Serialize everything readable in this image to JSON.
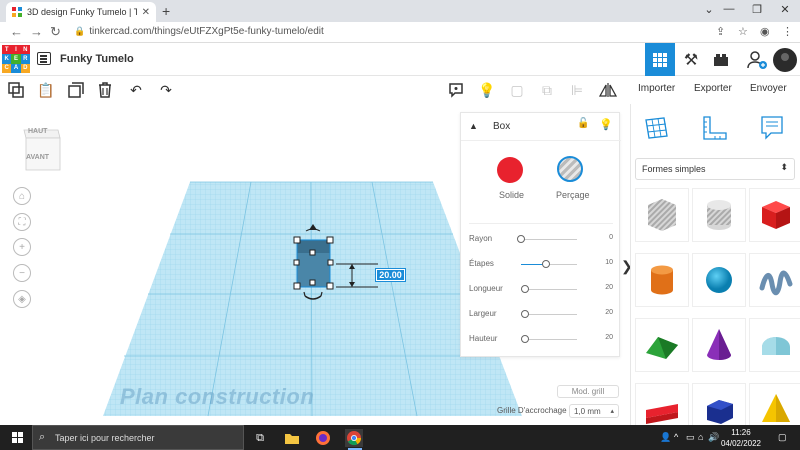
{
  "browser": {
    "tab_title": "3D design Funky Tumelo | Tinker",
    "tab_close": "✕",
    "new_tab": "+",
    "url": "tinkercad.com/things/eUtFZXgPt5e-funky-tumelo/edit"
  },
  "app": {
    "logo_letters": [
      "TIN",
      "KER",
      "CAD"
    ],
    "project_name": "Funky Tumelo"
  },
  "toolbar": {
    "import_label": "Importer",
    "export_label": "Exporter",
    "send_label": "Envoyer"
  },
  "viewcube": {
    "top_label": "HAUT",
    "front_label": "AVANT"
  },
  "workplane": {
    "label": "Plan construction",
    "dimension_value": "20.00"
  },
  "properties": {
    "shape_name": "Box",
    "solid_label": "Solide",
    "hole_label": "Perçage",
    "solid_color": "#e8222e",
    "rows": [
      {
        "label": "Rayon",
        "value": "0",
        "level": 0.0
      },
      {
        "label": "Étapes",
        "value": "10",
        "level": 0.45
      },
      {
        "label": "Longueur",
        "value": "20",
        "level": 0.08
      },
      {
        "label": "Largeur",
        "value": "20",
        "level": 0.08
      },
      {
        "label": "Hauteur",
        "value": "20",
        "level": 0.08
      }
    ],
    "edit_grid_label": "Mod. grill",
    "snap_grid_label": "Grille D'accrochage",
    "snap_grid_value": "1,0 mm"
  },
  "library": {
    "category": "Formes simples",
    "shapes": [
      "box-hole",
      "cylinder-hole",
      "box",
      "cylinder",
      "sphere",
      "scribble",
      "roof",
      "cone",
      "round-roof",
      "text",
      "hexagonal-prism",
      "pyramid"
    ]
  },
  "taskbar": {
    "search_placeholder": "Taper ici pour rechercher",
    "time": "11:26",
    "date": "04/02/2022"
  }
}
